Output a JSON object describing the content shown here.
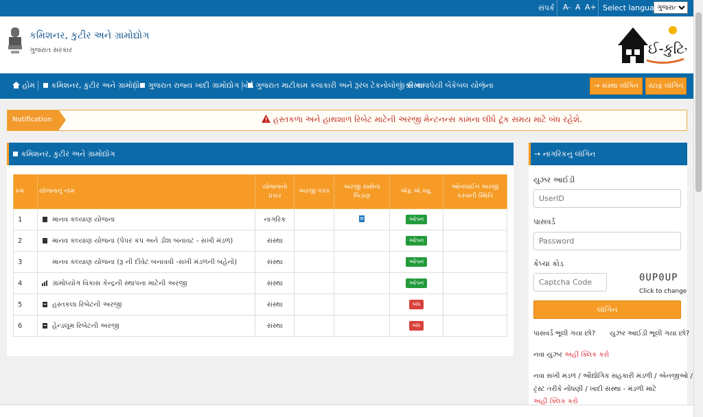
{
  "topbar": {
    "contact": "સંપર્ક",
    "font_small": "A-",
    "font_normal": "A",
    "font_large": "A+",
    "language_label": "Select language:",
    "language_selected": "ગુજરાતી"
  },
  "header": {
    "org_name": "કમિશનર, કુટીર અને ગ્રામોદ્યોગ",
    "org_sub": "ગુજરાત સરકાર",
    "logo_text": "ઈ-કુટિર"
  },
  "nav": {
    "items": [
      "હોમ",
      "કમિશનર, કુટીર અને ગ્રામોદ્યોગ",
      "ગુજરાત રાજ્ય ખાદી ગ્રામોદ્યોગ બોર્ડ",
      "ગુજરાત માટીકામ કલાકારી અને રૂરલ ટેકનોલોજી સંસ્થા",
      "શ્રી વાજપેયી બેંકેબલ યોજના"
    ],
    "institute_login": "સંસ્થા લૉગિન",
    "staff_login": "સ્ટાફ લૉગિન"
  },
  "notification": {
    "tag": "Notification",
    "text": "હસ્તકળા અને હાથશાળ રિબેટ માટેની અરજી મેન્ટનન્સ કામના લીધે ટૂંક સમય માટે બંધ રહેશે."
  },
  "schemes": {
    "title": "કમિશનર, કુટીર અને ગ્રામોદ્યોગ",
    "headers": [
      "ક્રમ",
      "યોજનાનું નામ",
      "યોજનાનો પ્રકાર",
      "અરજી પત્રક",
      "અરજી સાથેના બિડાણ",
      "એફ.એ.ક્યુ.",
      "ઓનલાઈન અરજી કરવાની સ્થિતિ"
    ],
    "rows": [
      {
        "no": "1",
        "name": "માનવ કલ્યાણ યોજના",
        "type": "નાગરિક",
        "status": "ઓપન"
      },
      {
        "no": "2",
        "name": "માનવ કલ્યાણ યોજના (પેપર કપ અને ડીશ બનાવટ - સખી મંડળ)",
        "type": "સંસ્થા",
        "status": "ઓપન"
      },
      {
        "no": "3",
        "name": "માનવ કલ્યાણ યોજના (રૂ ની દીવેટ બનાવવી -સખી મંડળની બહેનો)",
        "type": "સંસ્થા",
        "status": "ઓપન"
      },
      {
        "no": "4",
        "name": "ગ્રામોધ્યોગ વિકાસ કેન્દ્રની સ્થાપના માટેની અરજી",
        "type": "સંસ્થા",
        "status": "ઓપન"
      },
      {
        "no": "5",
        "name": "હસ્તકલા રિબેટની અરજી",
        "type": "સંસ્થા",
        "status": "બંધ"
      },
      {
        "no": "6",
        "name": "હેન્ડલૂમ રિબેટની અરજી",
        "type": "સંસ્થા",
        "status": "બંધ"
      }
    ]
  },
  "login": {
    "title": "નાગરિકનું લૉગિન",
    "user_label": "યુઝર આઈડી",
    "user_placeholder": "UserID",
    "pass_label": "પાસવર્ડ",
    "pass_placeholder": "Password",
    "captcha_label": "કેપ્ચા કોડ",
    "captcha_placeholder": "Captcha Code",
    "captcha_value": "0UP0UP",
    "captcha_refresh": "Click to change",
    "login_button": "લૉગિન",
    "forgot_password": "પાસવર્ડ ભૂલી ગયા છો?",
    "forgot_userid": "યુઝર આઈડી ભૂલી ગયા છો?",
    "new_user": "નવા યુઝર",
    "click_here": "અહીં ક્લિક કરો",
    "org_line1": "નવા સખી મંડળ / ઔદ્યોગિક સહકારી મંડળી / એનજીઓ /",
    "org_line2": "ટ્રસ્ટ તરીકે નોંધણી / ખાદી સંસ્થા - મંડળી માટે"
  },
  "colors": {
    "primary": "#0d6aa8",
    "accent": "#f59b26",
    "open": "#239b3b",
    "closed": "#d9413b"
  }
}
